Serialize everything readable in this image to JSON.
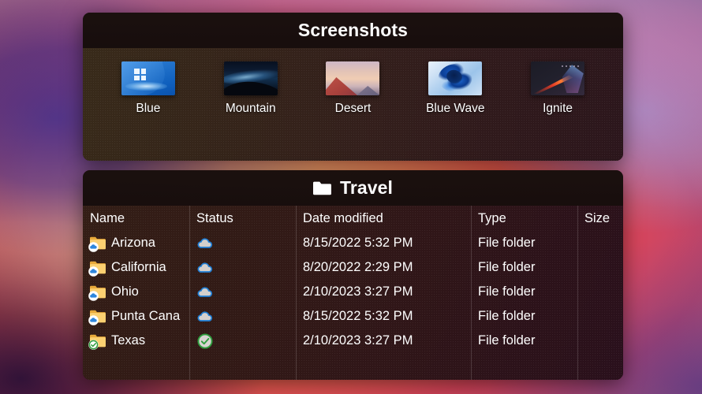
{
  "wallpaper": {
    "name": "windows-bloom-swirl-gradient",
    "colors": [
      "#ffe9ae",
      "#ff8c5f",
      "#d9455a",
      "#c66a93",
      "#8f9fd4",
      "#3d3a7a"
    ]
  },
  "screenshots_panel": {
    "title": "Screenshots",
    "items": [
      {
        "label": "Blue",
        "art": "blue"
      },
      {
        "label": "Mountain",
        "art": "mountain"
      },
      {
        "label": "Desert",
        "art": "desert"
      },
      {
        "label": "Blue Wave",
        "art": "bluewave"
      },
      {
        "label": "Ignite",
        "art": "ignite"
      }
    ]
  },
  "travel_panel": {
    "title": "Travel",
    "title_icon": "folder-icon",
    "columns": [
      "Name",
      "Status",
      "Date modified",
      "Type",
      "Size"
    ],
    "rows": [
      {
        "name": "Arizona",
        "status_icon": "cloud-icon",
        "badge": "cloud-badge",
        "date": "8/15/2022 5:32 PM",
        "type": "File folder",
        "size": ""
      },
      {
        "name": "California",
        "status_icon": "cloud-icon",
        "badge": "cloud-badge",
        "date": "8/20/2022 2:29 PM",
        "type": "File folder",
        "size": ""
      },
      {
        "name": "Ohio",
        "status_icon": "cloud-icon",
        "badge": "cloud-badge",
        "date": "2/10/2023 3:27 PM",
        "type": "File folder",
        "size": ""
      },
      {
        "name": "Punta Cana",
        "status_icon": "cloud-icon",
        "badge": "cloud-badge",
        "date": "8/15/2022 5:32 PM",
        "type": "File folder",
        "size": ""
      },
      {
        "name": "Texas",
        "status_icon": "green-check-icon",
        "badge": "check-badge",
        "date": "2/10/2023 3:27 PM",
        "type": "File folder",
        "size": ""
      }
    ]
  },
  "colors": {
    "panel_title_bg": "#1a100e",
    "panel_body_tint": "#341e16",
    "text": "#ffffff",
    "folder_yellow": "#f7cb5f",
    "cloud_blue": "#2b7fd4",
    "check_green": "#3aa33a"
  }
}
